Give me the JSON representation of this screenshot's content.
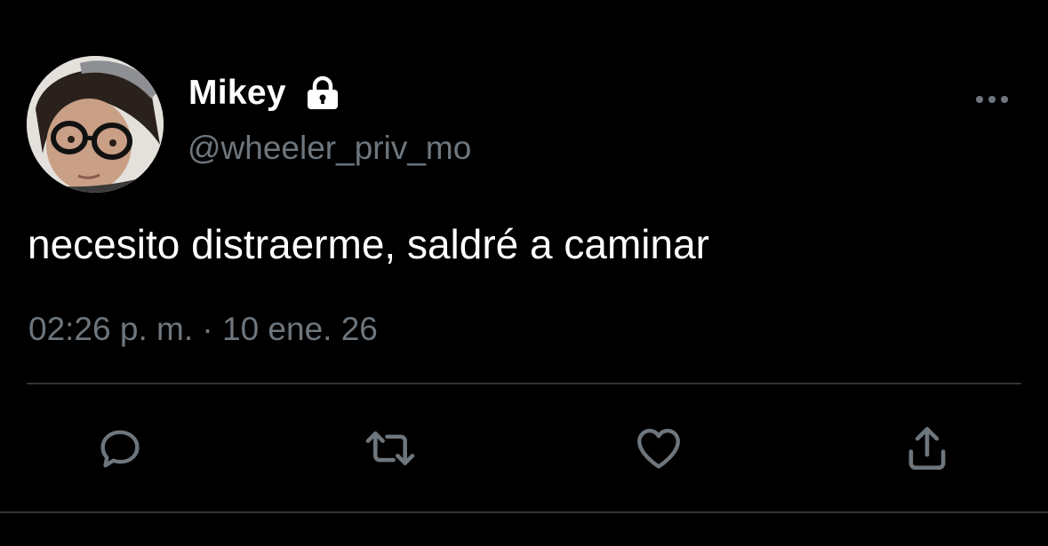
{
  "tweet": {
    "display_name": "Mikey",
    "protected_icon": "lock-icon",
    "handle": "@wheeler_priv_mo",
    "text": "necesito distraerme, saldré a caminar",
    "time": "02:26 p. m.",
    "separator": "·",
    "date": "10 ene. 26"
  },
  "actions": {
    "reply_icon": "reply-icon",
    "retweet_icon": "retweet-icon",
    "like_icon": "heart-icon",
    "share_icon": "share-icon",
    "more_icon": "more-options-icon"
  },
  "colors": {
    "background": "#000000",
    "primary_text": "#ffffff",
    "secondary_text": "#6e767d",
    "divider": "#2f3336",
    "icon": "#6e767d"
  }
}
